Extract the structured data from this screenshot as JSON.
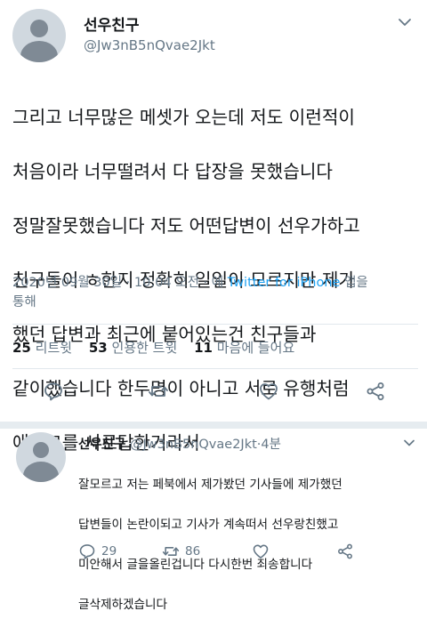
{
  "tweet": {
    "name": "선우친구",
    "handle": "@Jw3nB5nQvae2Jkt",
    "lines": [
      "그리고 너무많은 메셋가 오는데 저도 이런적이",
      "처음이라 너무떨려서 다 답장을 못했습니다",
      "정말잘못했습니다 저도 어떤답변이 선우가하고",
      "친구들이 ㅎ한지 정확히 일일이 모르지만 제가",
      "했던 답변과 최근에 붙어있는건 친구들과",
      "같이했습니다 한두명이 아니고 서로 유행처럼",
      "애스크를 서로답한거라서"
    ],
    "timestamp": "2020년 09월 30일 · 10:04 오전 · 에 ",
    "source": "Twitter for iPhone",
    "source_suffix": " 앱을",
    "source_suffix2": "통해",
    "retweets_count": "25",
    "retweets_label": "리트윗",
    "quotes_count": "53",
    "quotes_label": "인용한 트윗",
    "likes_count": "11",
    "likes_label": "마음에 들어요"
  },
  "reply": {
    "name": "선우친구",
    "handle_time": " @Jw3nB5nQvae2Jkt·4분",
    "lines": [
      "잘모르고 저는 페북에서 제가봤던 기사들에 제가했던",
      "답변들이 논란이되고 기사가 계속떠서 선우랑친했고",
      "미안해서 글을올린겁니다 다시한번 죄송합니다",
      "글삭제하겠습니다"
    ],
    "reply_count": "29",
    "retweet_count": "86"
  },
  "colors": {
    "accent": "#1da1f2",
    "secondary_text": "#657786",
    "icon": "#657786",
    "divider": "#e1e8ed"
  },
  "icons": [
    "chevron-down-icon",
    "reply-icon",
    "retweet-icon",
    "like-icon",
    "share-icon"
  ]
}
